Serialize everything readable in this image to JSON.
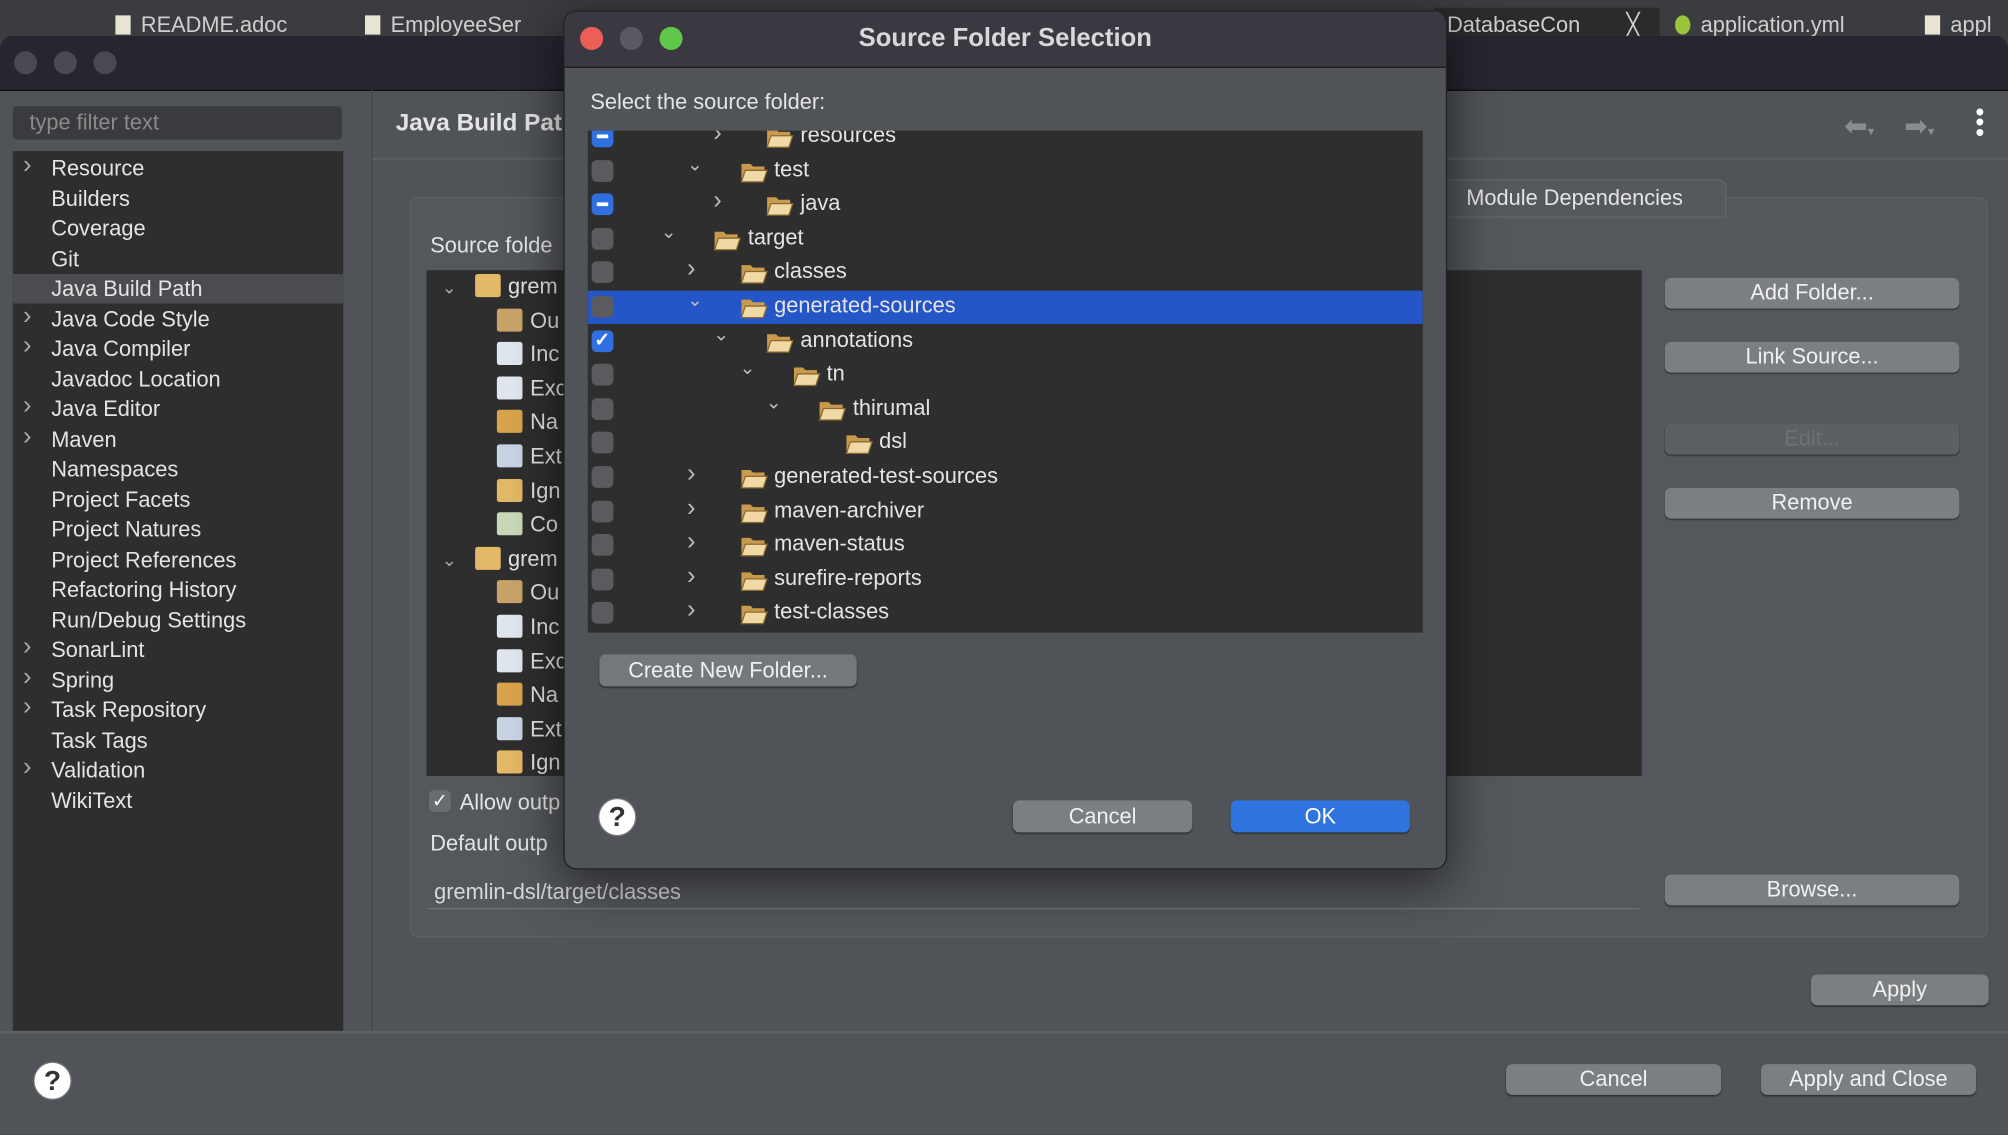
{
  "editor_tabs": [
    {
      "label": "README.adoc",
      "active": false
    },
    {
      "label": "EmployeeSer",
      "active": false
    },
    {
      "label": "DatabaseCon",
      "active": true
    },
    {
      "label": "application.yml",
      "active": false
    },
    {
      "label": "appl",
      "active": false
    }
  ],
  "preferences": {
    "filter_placeholder": "type filter text",
    "nav": [
      {
        "label": "Resource",
        "expandable": true
      },
      {
        "label": "Builders"
      },
      {
        "label": "Coverage"
      },
      {
        "label": "Git"
      },
      {
        "label": "Java Build Path",
        "selected": true
      },
      {
        "label": "Java Code Style",
        "expandable": true
      },
      {
        "label": "Java Compiler",
        "expandable": true
      },
      {
        "label": "Javadoc Location"
      },
      {
        "label": "Java Editor",
        "expandable": true
      },
      {
        "label": "Maven",
        "expandable": true
      },
      {
        "label": "Namespaces"
      },
      {
        "label": "Project Facets"
      },
      {
        "label": "Project Natures"
      },
      {
        "label": "Project References"
      },
      {
        "label": "Refactoring History"
      },
      {
        "label": "Run/Debug Settings"
      },
      {
        "label": "SonarLint",
        "expandable": true
      },
      {
        "label": "Spring",
        "expandable": true
      },
      {
        "label": "Task Repository",
        "expandable": true
      },
      {
        "label": "Task Tags"
      },
      {
        "label": "Validation",
        "expandable": true
      },
      {
        "label": "WikiText"
      }
    ],
    "page_title": "Java Build Pat",
    "tab_module_dependencies": "Module Dependencies",
    "source_folders_label": "Source folde",
    "source_tree": [
      {
        "label": "grem",
        "level": 0,
        "icon": "source-folder"
      },
      {
        "label": "Ou",
        "level": 1,
        "icon": "output-folder"
      },
      {
        "label": "Inc",
        "level": 1,
        "icon": "filter-include"
      },
      {
        "label": "Exc",
        "level": 1,
        "icon": "filter-exclude"
      },
      {
        "label": "Na",
        "level": 1,
        "icon": "native-library"
      },
      {
        "label": "Ext",
        "level": 1,
        "icon": "external-annotations"
      },
      {
        "label": "Ign",
        "level": 1,
        "icon": "ignore-warnings"
      },
      {
        "label": "Co",
        "level": 1,
        "icon": "compiler-settings"
      },
      {
        "label": "grem",
        "level": 0,
        "icon": "source-folder"
      },
      {
        "label": "Ou",
        "level": 1,
        "icon": "output-folder"
      },
      {
        "label": "Inc",
        "level": 1,
        "icon": "filter-include"
      },
      {
        "label": "Exc",
        "level": 1,
        "icon": "filter-exclude"
      },
      {
        "label": "Na",
        "level": 1,
        "icon": "native-library"
      },
      {
        "label": "Ext",
        "level": 1,
        "icon": "external-annotations"
      },
      {
        "label": "Ign",
        "level": 1,
        "icon": "ignore-warnings"
      }
    ],
    "buttons": {
      "add_folder": "Add Folder...",
      "link_source": "Link Source...",
      "edit": "Edit...",
      "remove": "Remove",
      "browse": "Browse...",
      "apply": "Apply",
      "cancel": "Cancel",
      "apply_close": "Apply and Close"
    },
    "allow_output_label": "Allow outp",
    "allow_output_checked": true,
    "default_output_label": "Default outp",
    "default_output_value": "gremlin-dsl/target/classes"
  },
  "dialog": {
    "title": "Source Folder Selection",
    "prompt": "Select the source folder:",
    "tree": [
      {
        "label": "resources",
        "level": 2,
        "expanded": false,
        "check": "indeterminate"
      },
      {
        "label": "test",
        "level": 1,
        "expanded": true,
        "check": "unchecked"
      },
      {
        "label": "java",
        "level": 2,
        "expanded": false,
        "check": "indeterminate"
      },
      {
        "label": "target",
        "level": 0,
        "expanded": true,
        "check": "unchecked"
      },
      {
        "label": "classes",
        "level": 1,
        "expanded": false,
        "check": "unchecked"
      },
      {
        "label": "generated-sources",
        "level": 1,
        "expanded": true,
        "check": "unchecked",
        "selected": true
      },
      {
        "label": "annotations",
        "level": 2,
        "expanded": true,
        "check": "checked"
      },
      {
        "label": "tn",
        "level": 3,
        "expanded": true,
        "check": "unchecked"
      },
      {
        "label": "thirumal",
        "level": 4,
        "expanded": true,
        "check": "unchecked"
      },
      {
        "label": "dsl",
        "level": 5,
        "leaf": true,
        "check": "unchecked"
      },
      {
        "label": "generated-test-sources",
        "level": 1,
        "expanded": false,
        "check": "unchecked"
      },
      {
        "label": "maven-archiver",
        "level": 1,
        "expanded": false,
        "check": "unchecked"
      },
      {
        "label": "maven-status",
        "level": 1,
        "expanded": false,
        "check": "unchecked"
      },
      {
        "label": "surefire-reports",
        "level": 1,
        "expanded": false,
        "check": "unchecked"
      },
      {
        "label": "test-classes",
        "level": 1,
        "expanded": false,
        "check": "unchecked"
      }
    ],
    "create_folder": "Create New Folder...",
    "cancel": "Cancel",
    "ok": "OK"
  },
  "colors": {
    "accent": "#2456c8",
    "ok_button": "#2f74de",
    "close": "#ec5f57",
    "minimize": "#5a5860",
    "zoom": "#5fc74a",
    "folder": "#e9c98b"
  }
}
